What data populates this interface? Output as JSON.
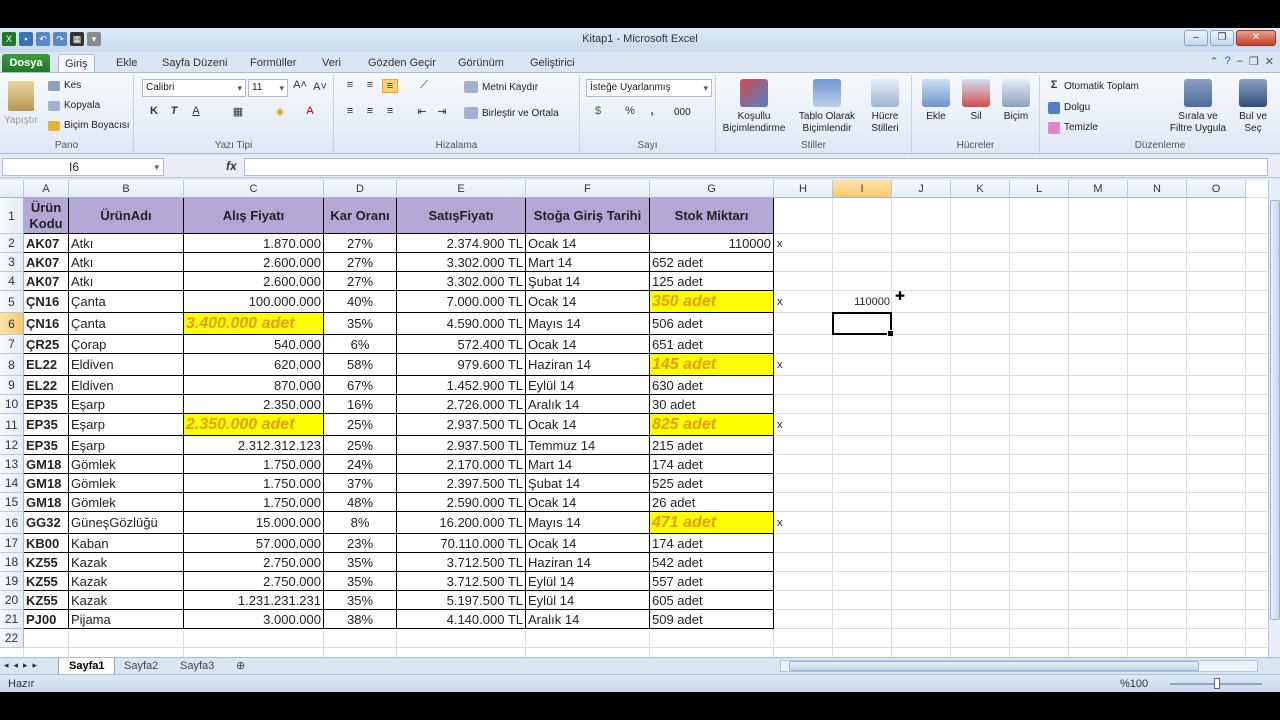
{
  "window": {
    "title": "Kitap1 - Microsoft Excel"
  },
  "tabs": [
    "Dosya",
    "Giriş",
    "Ekle",
    "Sayfa Düzeni",
    "Formüller",
    "Veri",
    "Gözden Geçir",
    "Görünüm",
    "Geliştirici"
  ],
  "ribbon": {
    "clipboard": {
      "paste": "Yapıştır",
      "cut": "Kes",
      "copy": "Kopyala",
      "format_painter": "Biçim Boyacısı",
      "label": "Pano"
    },
    "font": {
      "name": "Calibri",
      "size": "11",
      "label": "Yazı Tipi",
      "bold": "K",
      "italic": "T",
      "underline": "A"
    },
    "alignment": {
      "wrap": "Metni Kaydır",
      "merge": "Birleştir ve Ortala",
      "label": "Hizalama"
    },
    "number": {
      "format": "İsteğe Uyarlanmış",
      "percent": "%",
      "comma": "000",
      "label": "Sayı"
    },
    "styles": {
      "conditional": "Koşullu Biçimlendirme",
      "table": "Tablo Olarak Biçimlendir",
      "cell": "Hücre Stilleri",
      "label": "Stiller"
    },
    "cells": {
      "insert": "Ekle",
      "delete": "Sil",
      "format": "Biçim",
      "label": "Hücreler"
    },
    "editing": {
      "autosum": "Otomatik Toplam",
      "fill": "Dolgu",
      "clear": "Temizle",
      "sort": "Sırala ve Filtre Uygula",
      "find": "Bul ve Seç",
      "label": "Düzenleme"
    }
  },
  "formula_bar": {
    "name_box": "I6",
    "fx": "fx",
    "value": ""
  },
  "columns": [
    "A",
    "B",
    "C",
    "D",
    "E",
    "F",
    "G",
    "H",
    "I",
    "J",
    "K",
    "L",
    "M",
    "N",
    "O"
  ],
  "rows": [
    "1",
    "2",
    "3",
    "4",
    "5",
    "6",
    "7",
    "8",
    "9",
    "10",
    "11",
    "12",
    "13",
    "14",
    "15",
    "16",
    "17",
    "18",
    "19",
    "20",
    "21",
    "22"
  ],
  "headers": [
    "Ürün Kodu",
    "ÜrünAdı",
    "Alış Fiyatı",
    "Kar Oranı",
    "SatışFiyatı",
    "Stoğa Giriş Tarihi",
    "Stok Miktarı"
  ],
  "table": [
    [
      "AK07",
      "Atkı",
      "1.870.000",
      "27%",
      "2.374.900 TL",
      "Ocak 14",
      "110000"
    ],
    [
      "AK07",
      "Atkı",
      "2.600.000",
      "27%",
      "3.302.000 TL",
      "Mart 14",
      "652 adet"
    ],
    [
      "AK07",
      "Atkı",
      "2.600.000",
      "27%",
      "3.302.000 TL",
      "Şubat 14",
      "125 adet"
    ],
    [
      "ÇN16",
      "Çanta",
      "100.000.000",
      "40%",
      "7.000.000 TL",
      "Ocak 14",
      "350 adet"
    ],
    [
      "ÇN16",
      "Çanta",
      "3.400.000 adet",
      "35%",
      "4.590.000 TL",
      "Mayıs 14",
      "506 adet"
    ],
    [
      "ÇR25",
      "Çorap",
      "540.000",
      "6%",
      "572.400 TL",
      "Ocak 14",
      "651 adet"
    ],
    [
      "EL22",
      "Eldiven",
      "620.000",
      "58%",
      "979.600 TL",
      "Haziran 14",
      "145 adet"
    ],
    [
      "EL22",
      "Eldiven",
      "870.000",
      "67%",
      "1.452.900 TL",
      "Eylül 14",
      "630 adet"
    ],
    [
      "EP35",
      "Eşarp",
      "2.350.000",
      "16%",
      "2.726.000 TL",
      "Aralık 14",
      "30 adet"
    ],
    [
      "EP35",
      "Eşarp",
      "2.350.000 adet",
      "25%",
      "2.937.500 TL",
      "Ocak 14",
      "825 adet"
    ],
    [
      "EP35",
      "Eşarp",
      "2.312.312.123",
      "25%",
      "2.937.500 TL",
      "Temmuz 14",
      "215 adet"
    ],
    [
      "GM18",
      "Gömlek",
      "1.750.000",
      "24%",
      "2.170.000 TL",
      "Mart 14",
      "174 adet"
    ],
    [
      "GM18",
      "Gömlek",
      "1.750.000",
      "37%",
      "2.397.500 TL",
      "Şubat 14",
      "525 adet"
    ],
    [
      "GM18",
      "Gömlek",
      "1.750.000",
      "48%",
      "2.590.000 TL",
      "Ocak 14",
      "26 adet"
    ],
    [
      "GG32",
      "GüneşGözlüğü",
      "15.000.000",
      "8%",
      "16.200.000 TL",
      "Mayıs 14",
      "471 adet"
    ],
    [
      "KB00",
      "Kaban",
      "57.000.000",
      "23%",
      "70.110.000 TL",
      "Ocak 14",
      "174 adet"
    ],
    [
      "KZ55",
      "Kazak",
      "2.750.000",
      "35%",
      "3.712.500 TL",
      "Haziran 14",
      "542 adet"
    ],
    [
      "KZ55",
      "Kazak",
      "2.750.000",
      "35%",
      "3.712.500 TL",
      "Eylül 14",
      "557 adet"
    ],
    [
      "KZ55",
      "Kazak",
      "1.231.231.231",
      "35%",
      "5.197.500 TL",
      "Eylül 14",
      "605 adet"
    ],
    [
      "PJ00",
      "Pijama",
      "3.000.000",
      "38%",
      "4.140.000 TL",
      "Aralık 14",
      "509 adet"
    ]
  ],
  "extras": {
    "x_mark": "x",
    "i5_value": "110000"
  },
  "sheets": [
    "Sayfa1",
    "Sayfa2",
    "Sayfa3"
  ],
  "status": {
    "ready": "Hazır",
    "zoom": "%100"
  },
  "colors": {
    "header_fill": "#b4a7d6",
    "highlight_fill": "#ffff00",
    "highlight_text": "#e69b00"
  }
}
